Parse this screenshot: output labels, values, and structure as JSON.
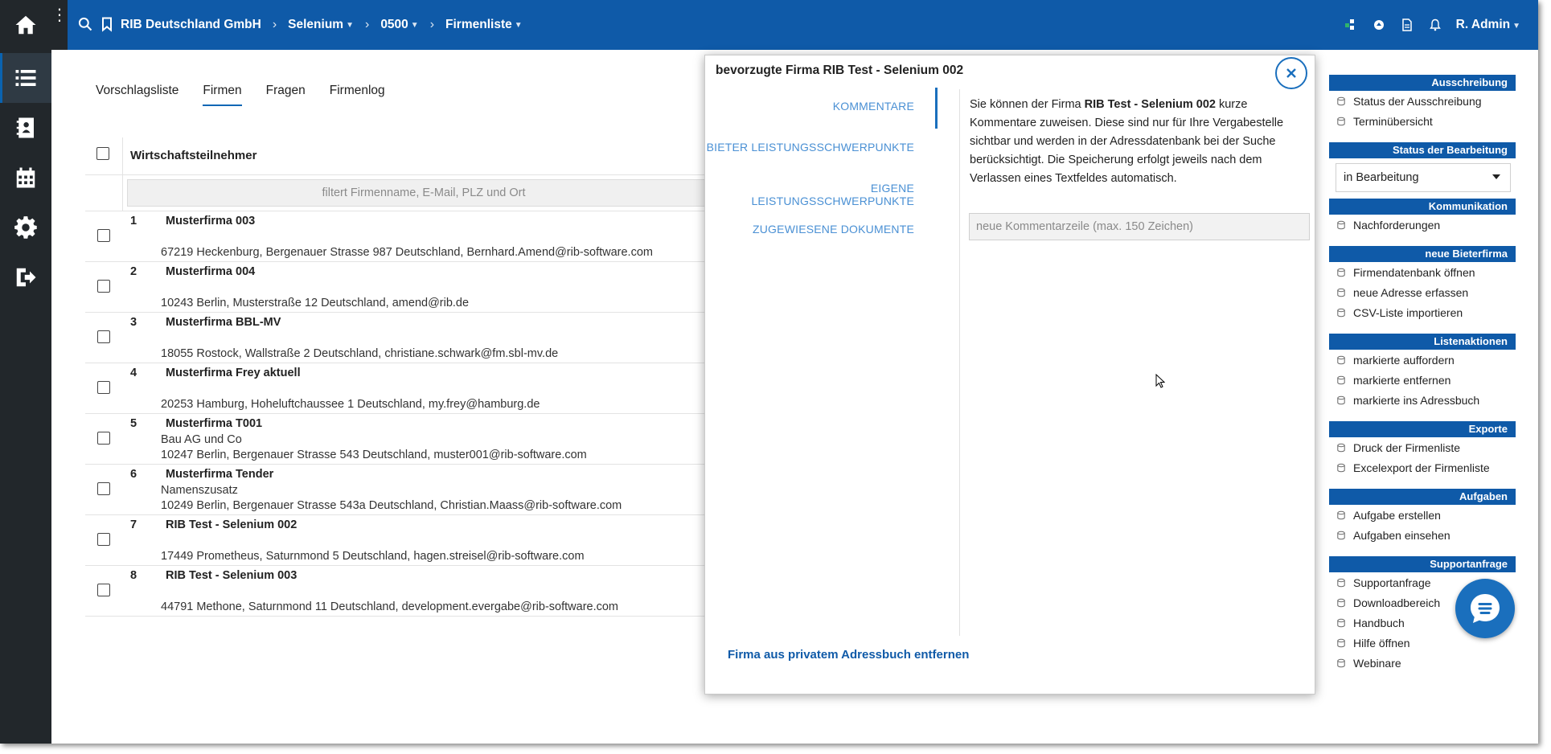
{
  "topbar": {
    "breadcrumbs": [
      {
        "label": "RIB Deutschland GmbH",
        "has_caret": false
      },
      {
        "label": "Selenium",
        "has_caret": true
      },
      {
        "label": "0500",
        "has_caret": true
      },
      {
        "label": "Firmenliste",
        "has_caret": true
      }
    ],
    "user_label": "R. Admin",
    "menu_glyph": "⋮"
  },
  "tabs": [
    {
      "label": "Vorschlagsliste",
      "active": false
    },
    {
      "label": "Firmen",
      "active": true
    },
    {
      "label": "Fragen",
      "active": false
    },
    {
      "label": "Firmenlog",
      "active": false
    }
  ],
  "grid": {
    "column_title": "Wirtschaftsteilnehmer",
    "filter_placeholder": "filtert Firmenname, E-Mail, PLZ und Ort",
    "rows": [
      {
        "num": "1",
        "name": "Musterfirma 003",
        "sub": "",
        "addr": "67219 Heckenburg, Bergenauer Strasse 987 Deutschland, Bernhard.Amend@rib-software.com"
      },
      {
        "num": "2",
        "name": "Musterfirma 004",
        "sub": "",
        "addr": "10243 Berlin, Musterstraße 12 Deutschland, amend@rib.de"
      },
      {
        "num": "3",
        "name": "Musterfirma BBL-MV",
        "sub": "",
        "addr": "18055 Rostock, Wallstraße 2 Deutschland, christiane.schwark@fm.sbl-mv.de"
      },
      {
        "num": "4",
        "name": "Musterfirma Frey aktuell",
        "sub": "",
        "addr": "20253 Hamburg, Hoheluftchaussee 1 Deutschland, my.frey@hamburg.de"
      },
      {
        "num": "5",
        "name": "Musterfirma T001",
        "sub": "Bau AG und Co",
        "addr": "10247 Berlin, Bergenauer Strasse 543 Deutschland, muster001@rib-software.com"
      },
      {
        "num": "6",
        "name": "Musterfirma Tender",
        "sub": "Namenszusatz",
        "addr": "10249 Berlin, Bergenauer Strasse 543a Deutschland, Christian.Maass@rib-software.com"
      },
      {
        "num": "7",
        "name": "RIB Test - Selenium 002",
        "sub": "",
        "addr": "17449 Prometheus, Saturnmond 5 Deutschland, hagen.streisel@rib-software.com"
      },
      {
        "num": "8",
        "name": "RIB Test - Selenium 003",
        "sub": "",
        "addr": "44791 Methone, Saturnmond 11 Deutschland, development.evergabe@rib-software.com"
      }
    ]
  },
  "modal": {
    "title": "bevorzugte Firma RIB Test - Selenium 002",
    "nav": [
      {
        "label": "KOMMENTARE",
        "active": true
      },
      {
        "label": "BIETER LEISTUNGSSCHWERPUNKTE",
        "active": false
      },
      {
        "label": "EIGENE LEISTUNGSSCHWERPUNKTE",
        "active": false
      },
      {
        "label": "ZUGEWIESENE DOKUMENTE",
        "active": false
      }
    ],
    "text_before": "Sie können der Firma ",
    "text_company": "RIB Test - Selenium 002",
    "text_after": " kurze Kommentare zuweisen. Diese sind nur für Ihre Vergabestelle sichtbar und werden in der Adressdatenbank bei der Suche berücksichtigt. Die Speicherung erfolgt jeweils nach dem Verlassen eines Textfeldes automatisch.",
    "comment_placeholder": "neue Kommentarzeile (max. 150 Zeichen)",
    "footer_link": "Firma aus privatem Adressbuch entfernen"
  },
  "right_panel": {
    "sections": [
      {
        "title": "Ausschreibung",
        "items": [
          "Status der Ausschreibung",
          "Terminübersicht"
        ]
      },
      {
        "title": "Status der Bearbeitung",
        "select_value": "in Bearbeitung",
        "items": []
      },
      {
        "title": "Kommunikation",
        "items": [
          "Nachforderungen"
        ]
      },
      {
        "title": "neue Bieterfirma",
        "items": [
          "Firmendatenbank öffnen",
          "neue Adresse erfassen",
          "CSV-Liste importieren"
        ]
      },
      {
        "title": "Listenaktionen",
        "items": [
          "markierte auffordern",
          "markierte entfernen",
          "markierte ins Adressbuch"
        ]
      },
      {
        "title": "Exporte",
        "items": [
          "Druck der Firmenliste",
          "Excelexport der Firmenliste"
        ]
      },
      {
        "title": "Aufgaben",
        "items": [
          "Aufgabe erstellen",
          "Aufgaben einsehen"
        ]
      },
      {
        "title": "Supportanfrage",
        "items": [
          "Supportanfrage",
          "Downloadbereich",
          "Handbuch",
          "Hilfe öffnen",
          "Webinare"
        ]
      }
    ]
  },
  "colors": {
    "brand_blue": "#0f5aa8",
    "rail_dark": "#22272b",
    "link_light_blue": "#4a90d4"
  },
  "icons": [
    "home-icon",
    "list-icon",
    "address-book-icon",
    "calendar-icon",
    "gear-icon",
    "logout-icon",
    "search-icon",
    "bookmark-icon",
    "bell-icon",
    "close-icon",
    "chat-icon"
  ]
}
